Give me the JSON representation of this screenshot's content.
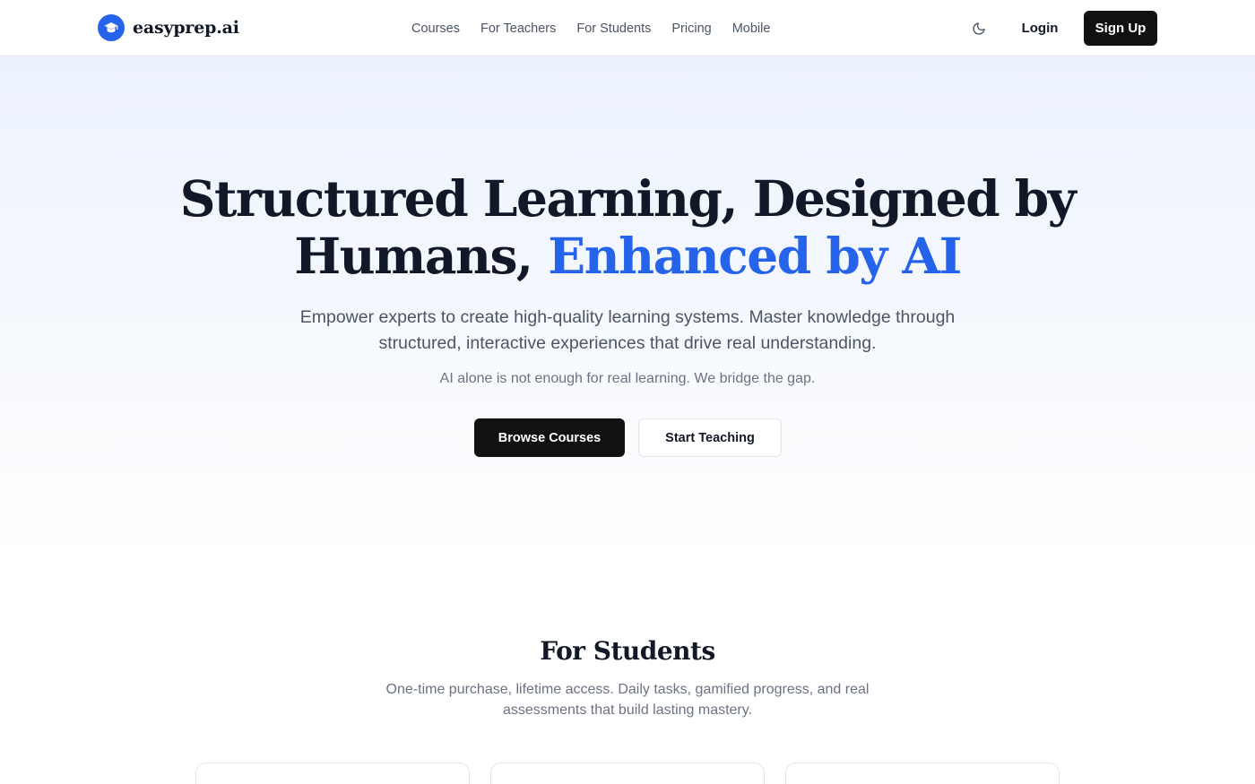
{
  "brand": {
    "name": "easyprep.ai",
    "accent_color": "#2563eb",
    "logo_icon": "graduation-cap-icon"
  },
  "nav": {
    "items": [
      {
        "label": "Courses"
      },
      {
        "label": "For Teachers"
      },
      {
        "label": "For Students"
      },
      {
        "label": "Pricing"
      },
      {
        "label": "Mobile"
      }
    ]
  },
  "header": {
    "theme_icon": "moon-icon",
    "login_label": "Login",
    "signup_label": "Sign Up"
  },
  "hero": {
    "title_line1": "Structured Learning, Designed by",
    "title_line2_plain": "Humans, ",
    "title_line2_accent": "Enhanced by AI",
    "subtitle": "Empower experts to create high-quality learning systems. Master knowledge through structured, interactive experiences that drive real understanding.",
    "note": "AI alone is not enough for real learning. We bridge the gap.",
    "primary_cta": "Browse Courses",
    "secondary_cta": "Start Teaching"
  },
  "students": {
    "title": "For Students",
    "subtitle": "One-time purchase, lifetime access. Daily tasks, gamified progress, and real assessments that build lasting mastery."
  }
}
